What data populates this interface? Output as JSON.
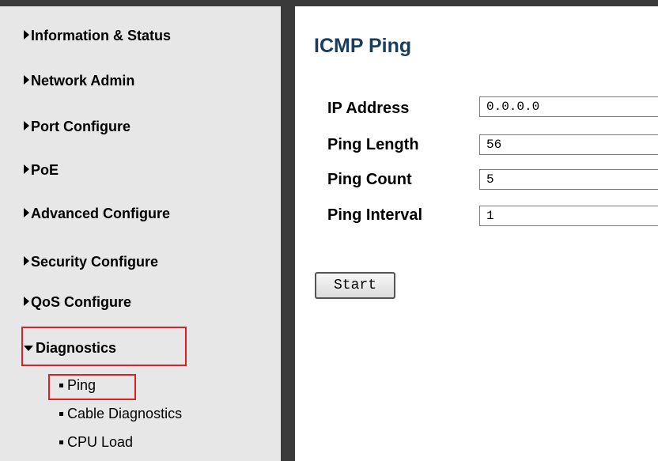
{
  "sidebar": {
    "items": [
      {
        "label": "Information & Status",
        "expanded": false
      },
      {
        "label": "Network Admin",
        "expanded": false
      },
      {
        "label": "Port Configure",
        "expanded": false
      },
      {
        "label": "PoE",
        "expanded": false
      },
      {
        "label": "Advanced Configure",
        "expanded": false
      },
      {
        "label": "Security Configure",
        "expanded": false
      },
      {
        "label": "QoS Configure",
        "expanded": false
      },
      {
        "label": "Diagnostics",
        "expanded": true
      }
    ],
    "diagnostics_children": [
      {
        "label": "Ping",
        "selected": true
      },
      {
        "label": "Cable Diagnostics",
        "selected": false
      },
      {
        "label": "CPU Load",
        "selected": false
      }
    ]
  },
  "main": {
    "title": "ICMP Ping",
    "fields": [
      {
        "label": "IP Address",
        "value": "0.0.0.0"
      },
      {
        "label": "Ping Length",
        "value": "56"
      },
      {
        "label": "Ping Count",
        "value": "5"
      },
      {
        "label": "Ping Interval",
        "value": "1"
      }
    ],
    "start_label": "Start"
  },
  "colors": {
    "sidebar_bg": "#e7e7e7",
    "divider": "#3a3a3a",
    "title": "#1a3d5c",
    "highlight_box": "#e02020"
  }
}
